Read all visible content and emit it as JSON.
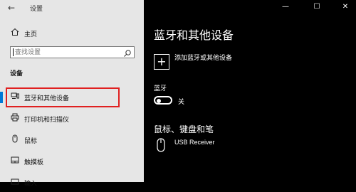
{
  "window": {
    "title": "设置",
    "back_glyph": "←",
    "controls": {
      "minimize": "—",
      "maximize": "☐",
      "close": "✕"
    }
  },
  "sidebar": {
    "home_label": "主页",
    "search_placeholder": "查找设置",
    "section_header": "设备",
    "items": [
      {
        "label": "蓝牙和其他设备",
        "icon": "bluetooth-devices-icon",
        "glyph": "⎙",
        "selected": true
      },
      {
        "label": "打印机和扫描仪",
        "icon": "printer-icon",
        "glyph": "⎙"
      },
      {
        "label": "鼠标",
        "icon": "mouse-icon",
        "glyph": "⌂"
      },
      {
        "label": "触摸板",
        "icon": "touchpad-icon",
        "glyph": "▭"
      },
      {
        "label": "输入",
        "icon": "keyboard-icon",
        "glyph": "⌨"
      }
    ]
  },
  "main": {
    "title": "蓝牙和其他设备",
    "add_device_label": "添加蓝牙或其他设备",
    "add_glyph": "+",
    "bluetooth_label": "蓝牙",
    "bluetooth_state": "关",
    "section_mouse": "鼠标、键盘和笔",
    "device_name": "USB Receiver"
  },
  "colors": {
    "sidebar_bg": "#e6e6e6",
    "main_bg": "#000000",
    "highlight_border": "#e02020",
    "accent": "#0078d7"
  }
}
